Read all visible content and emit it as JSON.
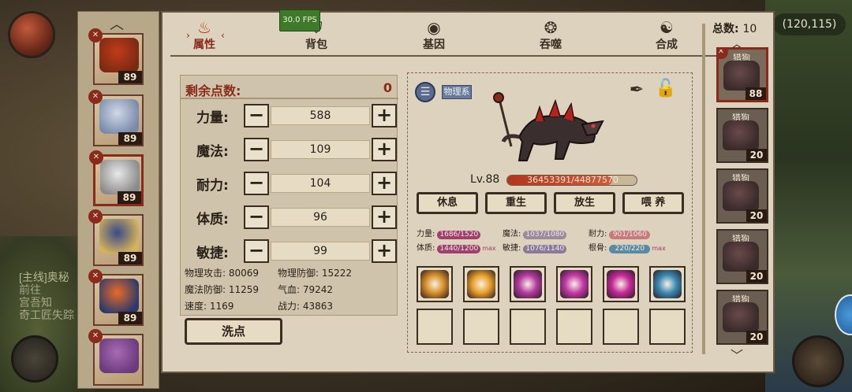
{
  "background": {
    "coords": "(120,115)",
    "quest_lines": [
      "[主线]奥秘",
      "前往",
      "宫吾知",
      "奇工匠失踪"
    ]
  },
  "heroes": [
    {
      "level": "89",
      "colors": [
        "#c23a1a",
        "#7a2a12"
      ]
    },
    {
      "level": "89",
      "colors": [
        "#cfd8e8",
        "#7a8aa8"
      ]
    },
    {
      "level": "89",
      "colors": [
        "#e8e8e8",
        "#8a8a8a"
      ]
    },
    {
      "level": "89",
      "colors": [
        "#3a4a8a",
        "#d4b45a"
      ]
    },
    {
      "level": "89",
      "colors": [
        "#e86a2a",
        "#2a3a6a"
      ]
    },
    {
      "level": "",
      "colors": [
        "#a86ab4",
        "#6a3a7a"
      ]
    }
  ],
  "tabs": [
    {
      "label": "属性",
      "icon": "flame-icon",
      "active": true
    },
    {
      "label": "背包",
      "icon": "bag-icon",
      "active": false
    },
    {
      "label": "基因",
      "icon": "eye-icon",
      "active": false
    },
    {
      "label": "吞噬",
      "icon": "swirl-icon",
      "active": false
    },
    {
      "label": "合成",
      "icon": "fusion-icon",
      "active": false
    }
  ],
  "fps": "30.0 FPS",
  "total": {
    "label": "总数:",
    "value": "10"
  },
  "points": {
    "label": "剩余点数:",
    "value": "0"
  },
  "attributes": [
    {
      "name": "力量:",
      "value": "588"
    },
    {
      "name": "魔法:",
      "value": "109"
    },
    {
      "name": "耐力:",
      "value": "104"
    },
    {
      "name": "体质:",
      "value": "96"
    },
    {
      "name": "敏捷:",
      "value": "99"
    }
  ],
  "derived": [
    {
      "label": "物理攻击:",
      "value": "80069"
    },
    {
      "label": "物理防御:",
      "value": "15222"
    },
    {
      "label": "魔法防御:",
      "value": "11259"
    },
    {
      "label": "气血:",
      "value": "79242"
    },
    {
      "label": "速度:",
      "value": "1169"
    },
    {
      "label": "战力:",
      "value": "43863"
    }
  ],
  "reset_label": "洗点",
  "pet": {
    "type_badge": "物理系",
    "level": "Lv.88",
    "hp": "36453391/44877570",
    "hp_fraction": 0.812,
    "actions": [
      "休息",
      "重生",
      "放生",
      "喂 养"
    ],
    "growth": [
      {
        "label": "力量:",
        "value": "1686/1520",
        "color": "#a0406a",
        "max": ""
      },
      {
        "label": "魔法:",
        "value": "1037/1080",
        "color": "#9a8a9a",
        "max": ""
      },
      {
        "label": "耐力:",
        "value": "901/1060",
        "color": "#c87a7a",
        "max": ""
      },
      {
        "label": "体质:",
        "value": "1440/1200",
        "color": "#a0406a",
        "max": "max"
      },
      {
        "label": "敏捷:",
        "value": "1076/1140",
        "color": "#8a7a9a",
        "max": ""
      },
      {
        "label": "根骨:",
        "value": "220/220",
        "color": "#5a8aa0",
        "max": "max"
      }
    ],
    "skills": [
      {
        "color": "#d8902a",
        "icon": "lightning-slash-icon"
      },
      {
        "color": "#e8a02a",
        "icon": "radiant-sun-icon"
      },
      {
        "color": "#b43aa0",
        "icon": "claw-slash-icon"
      },
      {
        "color": "#c43aa8",
        "icon": "arcane-claw-icon"
      },
      {
        "color": "#c42a9a",
        "icon": "magic-burst-icon"
      },
      {
        "color": "#3a8ab4",
        "icon": "ice-shard-icon"
      }
    ]
  },
  "pet_list": [
    {
      "name": "猎狗",
      "level": "88",
      "selected": true
    },
    {
      "name": "猎狗",
      "level": "20",
      "selected": false
    },
    {
      "name": "猎狗",
      "level": "20",
      "selected": false
    },
    {
      "name": "猎狗",
      "level": "20",
      "selected": false
    },
    {
      "name": "猎狗",
      "level": "20",
      "selected": false
    }
  ]
}
